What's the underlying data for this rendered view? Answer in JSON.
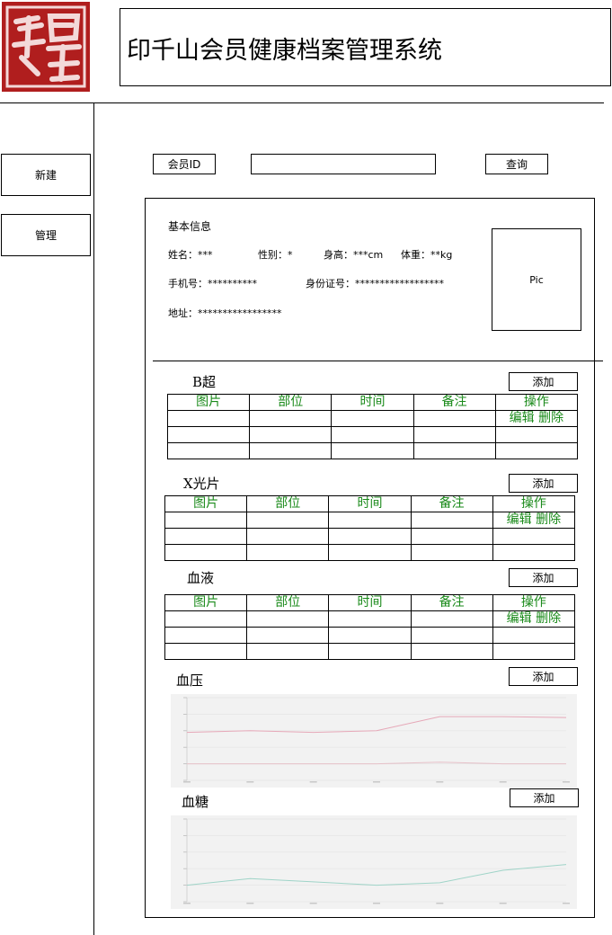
{
  "header": {
    "title": "印千山会员健康档案管理系统"
  },
  "sidebar": {
    "new_label": "新建",
    "manage_label": "管理"
  },
  "search": {
    "member_id_label": "会员ID",
    "input_value": "",
    "query_label": "查询"
  },
  "basic_info": {
    "heading": "基本信息",
    "name": "姓名：***",
    "gender": "性别：*",
    "height": "身高：***cm",
    "weight": "体重：**kg",
    "phone": "手机号：**********",
    "id_card": "身份证号：******************",
    "address": "地址：*****************",
    "photo_placeholder": "Pic"
  },
  "table_headers": [
    "图片",
    "部位",
    "时间",
    "备注",
    "操作"
  ],
  "row_actions": {
    "edit": "编辑",
    "delete": "删除"
  },
  "add_label": "添加",
  "sections": {
    "b_ultrasound": "B超",
    "xray": "X光片",
    "blood": "血液",
    "blood_pressure": "血压",
    "blood_sugar": "血糖"
  },
  "colors": {
    "seal_red": "#b01e1e",
    "action_green": "#1a8a1a",
    "bp_high_line": "#e6a8b8",
    "bp_low_line": "#e6c0c8",
    "sugar_line": "#9fd4c8",
    "chart_bg": "#f2f2f2"
  },
  "chart_data": [
    {
      "type": "line",
      "series": [
        {
          "values": [
            0.58,
            0.6,
            0.58,
            0.6,
            0.77,
            0.77,
            0.76
          ]
        },
        {
          "values": [
            0.2,
            0.2,
            0.2,
            0.2,
            0.22,
            0.2,
            0.2
          ]
        }
      ],
      "ylim": [
        0,
        1
      ],
      "grid": true
    },
    {
      "type": "line",
      "series": [
        {
          "values": [
            0.2,
            0.28,
            0.24,
            0.2,
            0.23,
            0.38,
            0.45
          ]
        }
      ],
      "ylim": [
        0,
        1
      ],
      "grid": true
    }
  ]
}
